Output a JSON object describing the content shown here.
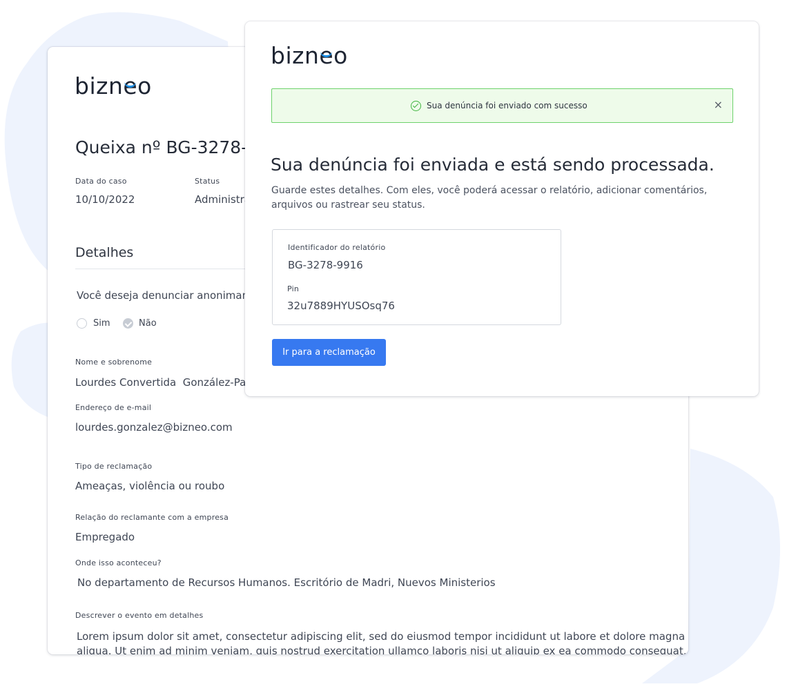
{
  "brand": {
    "logo": "bizneo"
  },
  "complaint": {
    "title": "Queixa nº BG-3278-",
    "case_date_label": "Data do caso",
    "case_date": "10/10/2022",
    "status_label": "Status",
    "status": "Administra",
    "details_heading": "Detalhes",
    "anonymous_question": "Você deseja denunciar anonimam",
    "option_yes": "Sim",
    "option_no": "Não",
    "name_label": "Nome e sobrenome",
    "name": "Lourdes Convertida  González-Pala",
    "email_label": "Endereço de e-mail",
    "email": "lourdes.gonzalez@bizneo.com",
    "type_label": "Tipo de reclamação",
    "type": "Ameaças, violência ou roubo",
    "relation_label": "Relação do reclamante com a empresa",
    "relation": "Empregado",
    "where_label": "Onde isso aconteceu?",
    "where": "No departamento de Recursos Humanos. Escritório de Madri, Nuevos Ministerios",
    "describe_label": "Descrever o evento em detalhes",
    "describe_line1": "Lorem ipsum dolor sit amet, consectetur adipiscing elit, sed do eiusmod tempor incididunt ut labore et dolore magna",
    "describe_line2": "aliqua. Ut enim ad minim veniam, quis nostrud exercitation ullamco laboris nisi ut aliquip ex ea commodo consequat."
  },
  "modal": {
    "alert_text": "Sua denúncia foi enviado com sucesso",
    "alert_close": "×",
    "heading": "Sua denúncia foi enviada e está sendo processada.",
    "description_line1": "Guarde estes detalhes. Com eles, você poderá acessar o relatório, adicionar comentários,",
    "description_line2": "arquivos ou rastrear seu status.",
    "report_id_label": "Identificador do relatório",
    "report_id": "BG-3278-9916",
    "pin_label": "Pin",
    "pin": "32u7889HYUSOsq76",
    "button_label": "Ir para a reclamação"
  },
  "colors": {
    "accent": "#3779f0",
    "success_border": "#6dd26b",
    "success_bg": "#eefbea",
    "background_blob": "#eef3fd"
  }
}
